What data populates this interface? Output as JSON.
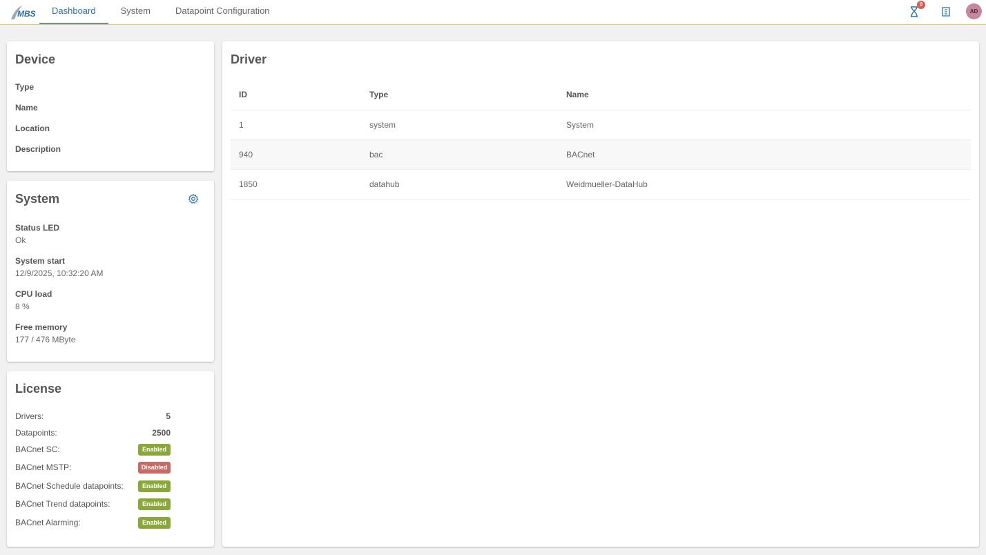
{
  "app": {
    "logo_text": "MBS"
  },
  "nav": {
    "tabs": [
      {
        "label": "Dashboard",
        "active": true
      },
      {
        "label": "System"
      },
      {
        "label": "Datapoint Configuration"
      }
    ]
  },
  "topbar": {
    "notification_count": "0",
    "avatar_initials": "AD",
    "icons": [
      "hourglass-icon",
      "clipboard-icon"
    ]
  },
  "device": {
    "title": "Device",
    "fields": [
      "Type",
      "Name",
      "Location",
      "Description"
    ]
  },
  "system": {
    "title": "System",
    "status_led_label": "Status LED",
    "status_led_value": "Ok",
    "system_start_label": "System start",
    "system_start_value": "12/9/2025, 10:32:20 AM",
    "cpu_label": "CPU load",
    "cpu_value": "8 %",
    "memory_label": "Free memory",
    "memory_value": "177 / 476 MByte"
  },
  "license": {
    "title": "License",
    "drivers_label": "Drivers:",
    "drivers_value": "5",
    "datapoints_label": "Datapoints:",
    "datapoints_value": "2500",
    "items": [
      {
        "label": "BACnet SC:",
        "status": "Enabled"
      },
      {
        "label": "BACnet MSTP:",
        "status": "Disabled"
      },
      {
        "label": "BACnet Schedule datapoints:",
        "status": "Enabled"
      },
      {
        "label": "BACnet Trend datapoints:",
        "status": "Enabled"
      },
      {
        "label": "BACnet Alarming:",
        "status": "Enabled"
      }
    ]
  },
  "driver": {
    "title": "Driver",
    "columns": [
      "ID",
      "Type",
      "Name"
    ],
    "rows": [
      {
        "id": "1",
        "type": "system",
        "name": "System"
      },
      {
        "id": "940",
        "type": "bac",
        "name": "BACnet"
      },
      {
        "id": "1850",
        "type": "datahub",
        "name": "Weidmueller-DataHub"
      }
    ]
  },
  "colors": {
    "accent_blue": "#2a6fb0",
    "enabled_green": "#8aa83a",
    "disabled_red": "#c76a64",
    "avatar_pink": "#c9849e"
  }
}
